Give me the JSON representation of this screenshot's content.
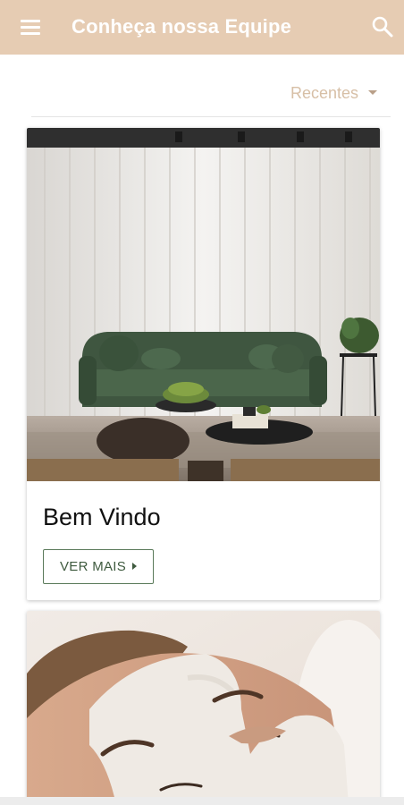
{
  "app": {
    "title": "Conheça nossa Equipe",
    "color_appbar": "#e6ccb3"
  },
  "icons": {
    "menu": "menu-icon",
    "search": "search-icon",
    "sort_caret": "caret-down-icon",
    "button_caret": "caret-right-icon"
  },
  "sort": {
    "label": "Recentes"
  },
  "cards": [
    {
      "title": "Bem Vindo",
      "button_label": "VER MAIS"
    }
  ]
}
